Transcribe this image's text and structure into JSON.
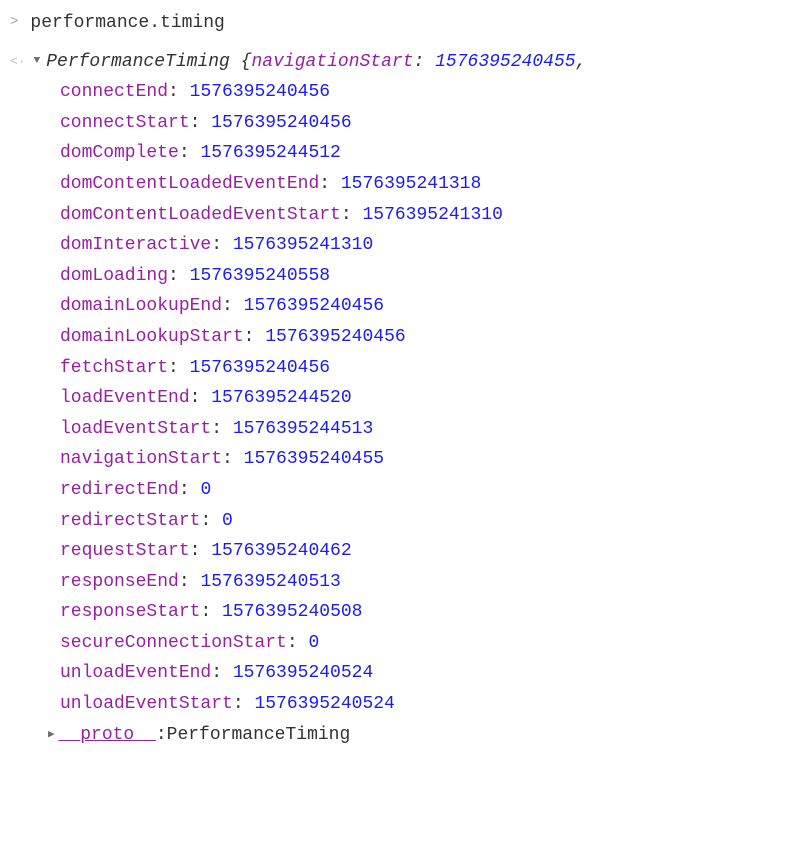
{
  "input": {
    "prompt": ">",
    "command": "performance.timing"
  },
  "output": {
    "return_icon": "<·",
    "expand_icon": "▼",
    "type_name": "PerformanceTiming",
    "brace_open": "{",
    "preview_key": "navigationStart",
    "preview_value": "1576395240455",
    "comma": ",",
    "properties": [
      {
        "key": "connectEnd",
        "value": "1576395240456"
      },
      {
        "key": "connectStart",
        "value": "1576395240456"
      },
      {
        "key": "domComplete",
        "value": "1576395244512"
      },
      {
        "key": "domContentLoadedEventEnd",
        "value": "1576395241318"
      },
      {
        "key": "domContentLoadedEventStart",
        "value": "1576395241310"
      },
      {
        "key": "domInteractive",
        "value": "1576395241310"
      },
      {
        "key": "domLoading",
        "value": "1576395240558"
      },
      {
        "key": "domainLookupEnd",
        "value": "1576395240456"
      },
      {
        "key": "domainLookupStart",
        "value": "1576395240456"
      },
      {
        "key": "fetchStart",
        "value": "1576395240456"
      },
      {
        "key": "loadEventEnd",
        "value": "1576395244520"
      },
      {
        "key": "loadEventStart",
        "value": "1576395244513"
      },
      {
        "key": "navigationStart",
        "value": "1576395240455"
      },
      {
        "key": "redirectEnd",
        "value": "0"
      },
      {
        "key": "redirectStart",
        "value": "0"
      },
      {
        "key": "requestStart",
        "value": "1576395240462"
      },
      {
        "key": "responseEnd",
        "value": "1576395240513"
      },
      {
        "key": "responseStart",
        "value": "1576395240508"
      },
      {
        "key": "secureConnectionStart",
        "value": "0"
      },
      {
        "key": "unloadEventEnd",
        "value": "1576395240524"
      },
      {
        "key": "unloadEventStart",
        "value": "1576395240524"
      }
    ],
    "proto": {
      "expand_icon": "▶",
      "key": "__proto__",
      "value": "PerformanceTiming"
    }
  }
}
